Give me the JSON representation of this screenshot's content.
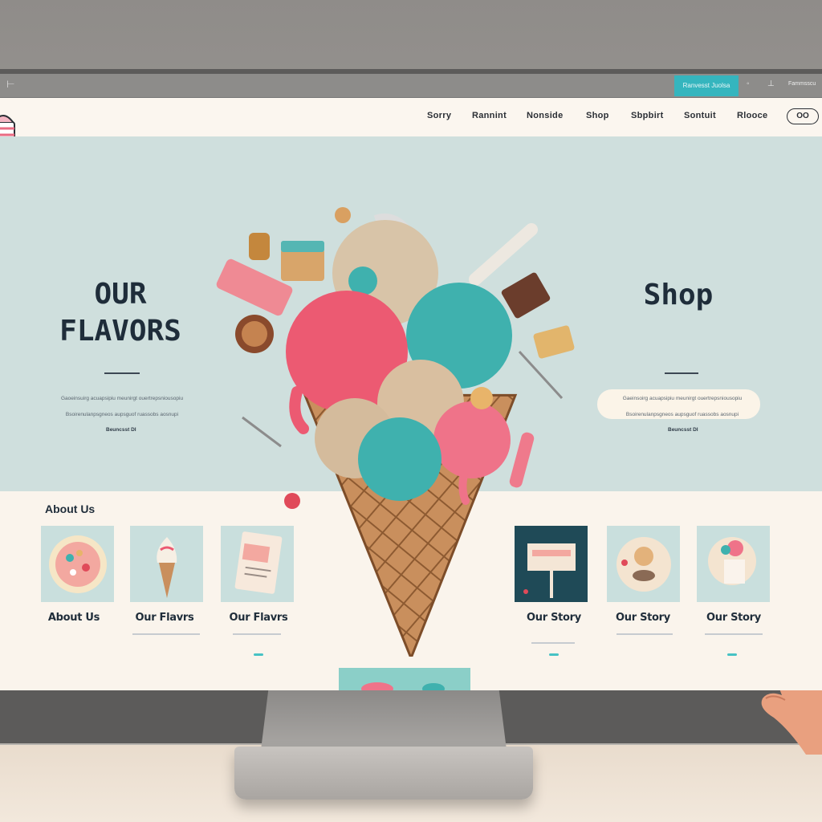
{
  "browser": {
    "badge_label": "Ranvesst Juolsa",
    "account_label": "Fammsscu"
  },
  "nav": {
    "items": [
      {
        "label": "Sorry"
      },
      {
        "label": "Rannint"
      },
      {
        "label": "Nonside"
      },
      {
        "label": "Shop"
      },
      {
        "label": "Sbpbirt"
      },
      {
        "label": "Sontuit"
      },
      {
        "label": "Rlooce"
      }
    ],
    "button_label": "OO"
  },
  "hero": {
    "left_title_line1": "OUR",
    "left_title_line2": "FLAVORS",
    "left_blurb_line1": "Gaoeinsuirg acuapsipiu meunirgt ouertrepsniousopiu",
    "left_blurb_line2": "Bsoirenulanpsgneos aupsguof ruassobs aosnupi",
    "left_meta": "Beuncsst DI",
    "right_title": "Shop",
    "right_blurb_line1": "Gaeinsoirg acuapsipiu meunirgt ouertrepsniousopiu",
    "right_blurb_line2": "Bsoirenulanpsgneos aupsguof ruassobs aosnupi",
    "right_meta": "Beuncsst DI",
    "shop_input_placeholder": ""
  },
  "section": {
    "heading": "About Us"
  },
  "cards": [
    {
      "caption": "About Us"
    },
    {
      "caption": "Our Flavrs"
    },
    {
      "caption": "Our Flavrs"
    },
    {
      "caption": "Our Story"
    },
    {
      "caption": "Our Story"
    },
    {
      "caption": "Our Story"
    }
  ],
  "colors": {
    "hero_background": "#cfdfdd",
    "page_background": "#faf4ec",
    "accent_teal": "#35b5be",
    "scoop_pink": "#ec5a72",
    "scoop_teal": "#3fb1ae",
    "text_dark": "#1f2d3a"
  },
  "icons": {
    "logo": "ice-cream-cup-logo",
    "cone": "ice-cream-cone-illustration",
    "back": "back-arrow-icon",
    "user": "user-icon"
  }
}
